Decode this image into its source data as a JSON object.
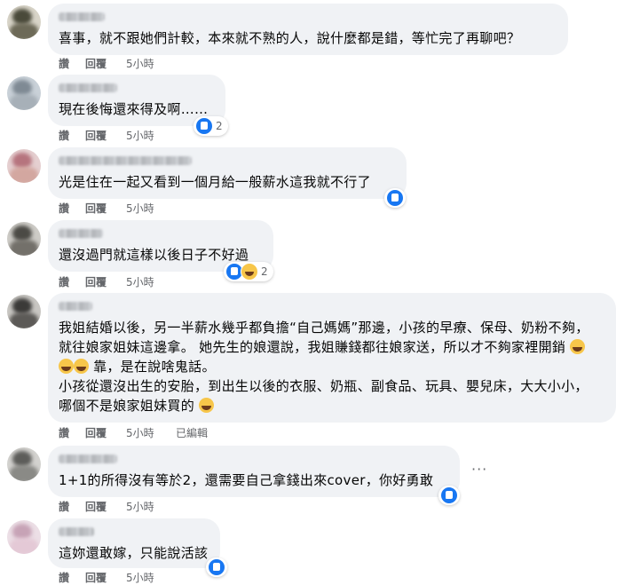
{
  "comments": [
    {
      "text": "喜事，就不跟她們計較，本來就不熟的人，說什麼都是錯，等忙完了再聊吧？",
      "actions": {
        "like": "讚",
        "reply": "回覆",
        "time": "5小時"
      },
      "avatar_colors": [
        "#4a4a3a",
        "#6d6a58"
      ]
    },
    {
      "text": "現在後悔還來得及啊……",
      "actions": {
        "like": "讚",
        "reply": "回覆",
        "time": "5小時"
      },
      "reactions": {
        "icons": [
          "like-icon"
        ],
        "count": "2"
      },
      "avatar_colors": [
        "#7f8a94",
        "#a7b0b8"
      ]
    },
    {
      "text": "光是住在一起又看到一個月給一般薪水這我就不行了",
      "actions": {
        "like": "讚",
        "reply": "回覆",
        "time": "5小時"
      },
      "reactions": {
        "icons": [
          "like-icon"
        ],
        "count": ""
      },
      "avatar_colors": [
        "#b6747e",
        "#d3a7a0"
      ]
    },
    {
      "text": "還沒過門就這樣以後日子不好過",
      "actions": {
        "like": "讚",
        "reply": "回覆",
        "time": "5小時"
      },
      "reactions": {
        "icons": [
          "like-icon",
          "haha-icon"
        ],
        "count": "2"
      },
      "avatar_colors": [
        "#4b4a45",
        "#73706a"
      ]
    },
    {
      "text": "我姐結婚以後，另一半薪水幾乎都負擔“自己媽媽”那邊，小孩的早療、保母、奶粉不夠，就往娘家姐妹這邊拿。 她先生的娘還說，我姐賺錢都往娘家送，所以才不夠家裡開銷",
      "text_line3_end": " 靠，是在說啥鬼話。",
      "text_para2": "小孩從還沒出生的安胎，到出生以後的衣服、奶瓶、副食品、玩具、嬰兒床，大大小小，哪個不是娘家姐妹買的",
      "actions": {
        "like": "讚",
        "reply": "回覆",
        "time": "5小時",
        "edited": "已編輯"
      },
      "avatar_colors": [
        "#3b3a38",
        "#5c5a57"
      ]
    },
    {
      "text": "1+1的所得沒有等於2，還需要自己拿錢出來cover，你好勇敢",
      "actions": {
        "like": "讚",
        "reply": "回覆",
        "time": "5小時"
      },
      "reactions": {
        "icons": [
          "like-icon"
        ],
        "count": ""
      },
      "more": "···",
      "avatar_colors": [
        "#5d5d5a",
        "#8a8a86"
      ]
    },
    {
      "text": "這妳還敢嫁，只能說活該",
      "actions": {
        "like": "讚",
        "reply": "回覆",
        "time": "5小時"
      },
      "reactions": {
        "icons": [
          "like-icon"
        ],
        "count": ""
      },
      "avatar_colors": [
        "#c7a3b6",
        "#e4c9d6"
      ]
    }
  ]
}
